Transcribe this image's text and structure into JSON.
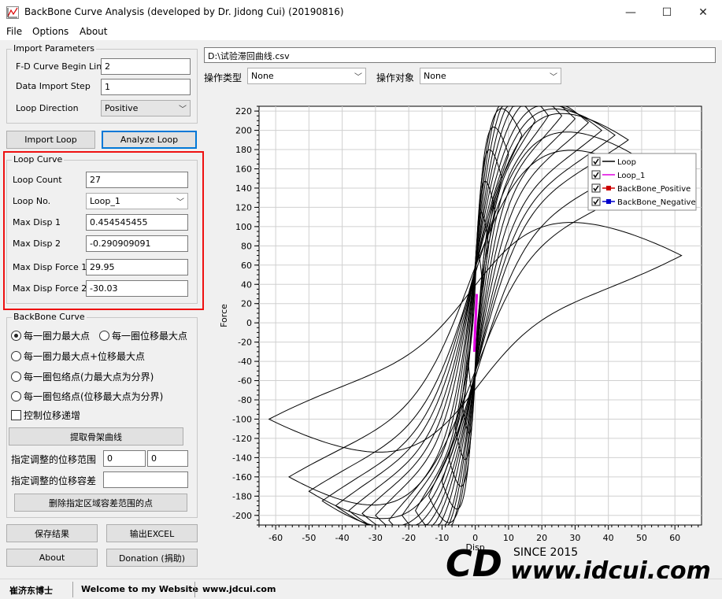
{
  "window": {
    "title": "BackBone Curve Analysis (developed by Dr. Jidong Cui) (20190816)",
    "minimize_glyph": "—",
    "maximize_glyph": "☐",
    "close_glyph": "✕"
  },
  "menu": {
    "file": "File",
    "options": "Options",
    "about": "About"
  },
  "import_params": {
    "title": "Import Parameters",
    "begin_line_label": "F-D Curve Begin Line",
    "begin_line_value": "2",
    "step_label": "Data Import Step",
    "step_value": "1",
    "direction_label": "Loop Direction",
    "direction_value": "Positive"
  },
  "buttons": {
    "import_loop": "Import Loop",
    "analyze_loop": "Analyze Loop",
    "extract_backbone": "提取骨架曲线",
    "delete_points": "删除指定区域容差范围的点",
    "save_result": "保存结果",
    "export_excel": "输出EXCEL",
    "about": "About",
    "donation": "Donation (捐助)"
  },
  "loop_curve": {
    "title": "Loop Curve",
    "count_label": "Loop Count",
    "count_value": "27",
    "no_label": "Loop No.",
    "no_value": "Loop_1",
    "max_disp1_label": "Max Disp 1",
    "max_disp1_value": "0.454545455",
    "max_disp2_label": "Max Disp 2",
    "max_disp2_value": "-0.290909091",
    "max_force1_label": "Max Disp Force 1",
    "max_force1_value": "29.95",
    "max_force2_label": "Max Disp Force 2",
    "max_force2_value": "-30.03"
  },
  "backbone": {
    "title": "BackBone Curve",
    "opt1": "每一圈力最大点",
    "opt2": "每一圈位移最大点",
    "opt3": "每一圈力最大点+位移最大点",
    "opt4": "每一圈包络点(力最大点为分界)",
    "opt5": "每一圈包络点(位移最大点为分界)",
    "selected_option": "opt1",
    "check_label": "控制位移递增",
    "range_label": "指定调整的位移范围",
    "range_from": "0",
    "range_to": "0",
    "tolerance_label": "指定调整的位移容差",
    "tolerance_value": ""
  },
  "file_path": "D:\\试验滞回曲线.csv",
  "op_type": {
    "label": "操作类型",
    "value": "None"
  },
  "op_target": {
    "label": "操作对象",
    "value": "None"
  },
  "statusbar": {
    "author": "崔济东博士",
    "welcome": "Welcome to my Website",
    "site": "www.jdcui.com"
  },
  "watermark": {
    "since": "SINCE 2015",
    "url": "www.jdcui.com",
    "logo_text": "CD"
  },
  "colors": {
    "accent": "#0078d7",
    "red_box": "#e11111",
    "loop1": "#e000e0",
    "positive": "#cc0000",
    "negative": "#0000cc"
  },
  "chart_data": {
    "type": "line",
    "xlabel": "Disp",
    "ylabel": "Force",
    "xlim": [
      -65,
      68
    ],
    "ylim": [
      -210,
      225
    ],
    "xticks": [
      -60,
      -50,
      -40,
      -30,
      -20,
      -10,
      0,
      10,
      20,
      30,
      40,
      50,
      60
    ],
    "yticks": [
      220,
      200,
      180,
      160,
      140,
      120,
      100,
      80,
      60,
      40,
      20,
      0,
      -20,
      -40,
      -60,
      -80,
      -100,
      -120,
      -140,
      -160,
      -180,
      -200
    ],
    "grid": true,
    "legend_position": "top-right",
    "legend": [
      "Loop",
      "Loop_1",
      "BackBone_Positive",
      "BackBone_Negative"
    ],
    "series": [
      {
        "name": "Loop",
        "color": "#000000",
        "loops": [
          {
            "dmax": 2,
            "fmax": 45,
            "dmin": -2,
            "fmin": -45
          },
          {
            "dmax": 4,
            "fmax": 80,
            "dmin": -4,
            "fmin": -80
          },
          {
            "dmax": 6,
            "fmax": 115,
            "dmin": -6,
            "fmin": -110
          },
          {
            "dmax": 8,
            "fmax": 150,
            "dmin": -8,
            "fmin": -140
          },
          {
            "dmax": 10,
            "fmax": 175,
            "dmin": -10,
            "fmin": -165
          },
          {
            "dmax": 14,
            "fmax": 195,
            "dmin": -14,
            "fmin": -180
          },
          {
            "dmax": 18,
            "fmax": 210,
            "dmin": -18,
            "fmin": -195
          },
          {
            "dmax": 22,
            "fmax": 215,
            "dmin": -22,
            "fmin": -200
          },
          {
            "dmax": 26,
            "fmax": 215,
            "dmin": -26,
            "fmin": -205
          },
          {
            "dmax": 30,
            "fmax": 212,
            "dmin": -30,
            "fmin": -200
          },
          {
            "dmax": 34,
            "fmax": 208,
            "dmin": -34,
            "fmin": -198
          },
          {
            "dmax": 38,
            "fmax": 200,
            "dmin": -38,
            "fmin": -195
          },
          {
            "dmax": 42,
            "fmax": 195,
            "dmin": -42,
            "fmin": -190
          },
          {
            "dmax": 46,
            "fmax": 190,
            "dmin": -46,
            "fmin": -185
          },
          {
            "dmax": 50,
            "fmax": 170,
            "dmin": -50,
            "fmin": -175
          },
          {
            "dmax": 54,
            "fmax": 150,
            "dmin": -56,
            "fmin": -160
          },
          {
            "dmax": 62,
            "fmax": 70,
            "dmin": -62,
            "fmin": -100
          }
        ]
      },
      {
        "name": "Loop_1",
        "color": "#e000e0",
        "x": [
          0.45,
          0.2,
          -0.29,
          -0.1,
          0.45
        ],
        "y": [
          29.95,
          10,
          -30.03,
          -10,
          29.95
        ]
      }
    ]
  }
}
